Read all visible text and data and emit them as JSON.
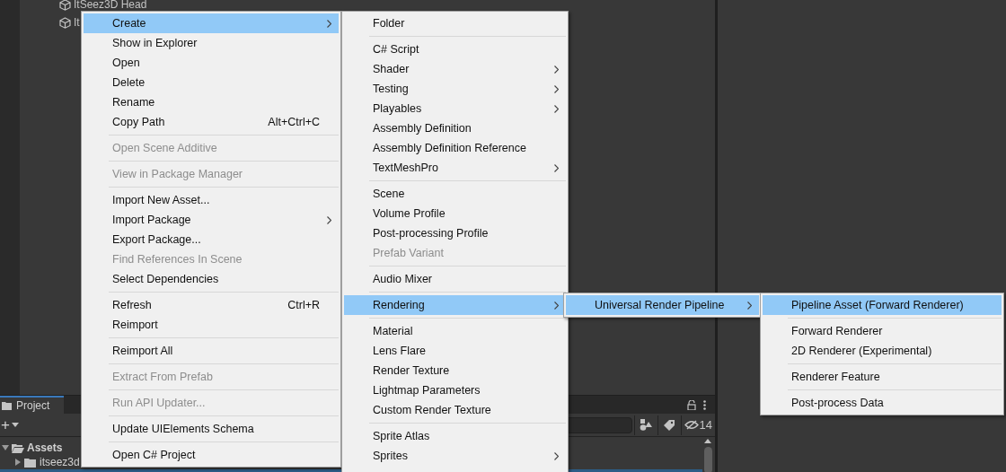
{
  "hierarchy": {
    "items": [
      {
        "label": "ItSeez3D Head"
      },
      {
        "label": "It"
      }
    ]
  },
  "project_panel": {
    "tab": "Project",
    "add_button": "+",
    "hidden_count": "14",
    "tree": [
      {
        "label": "Assets",
        "expanded": true,
        "children": [
          {
            "label": "itseez3d",
            "expanded": false
          }
        ]
      }
    ]
  },
  "menus": [
    {
      "items": [
        {
          "kind": "item",
          "label": "Create",
          "submenu": true,
          "selected": true,
          "disabled": false
        },
        {
          "kind": "item",
          "label": "Show in Explorer",
          "submenu": false,
          "selected": false,
          "disabled": false
        },
        {
          "kind": "item",
          "label": "Open",
          "submenu": false,
          "selected": false,
          "disabled": false
        },
        {
          "kind": "item",
          "label": "Delete",
          "submenu": false,
          "selected": false,
          "disabled": false
        },
        {
          "kind": "item",
          "label": "Rename",
          "submenu": false,
          "selected": false,
          "disabled": false
        },
        {
          "kind": "item",
          "label": "Copy Path",
          "shortcut": "Alt+Ctrl+C",
          "submenu": false,
          "selected": false,
          "disabled": false
        },
        {
          "kind": "separator"
        },
        {
          "kind": "item",
          "label": "Open Scene Additive",
          "submenu": false,
          "selected": false,
          "disabled": true
        },
        {
          "kind": "separator"
        },
        {
          "kind": "item",
          "label": "View in Package Manager",
          "submenu": false,
          "selected": false,
          "disabled": true
        },
        {
          "kind": "separator"
        },
        {
          "kind": "item",
          "label": "Import New Asset...",
          "submenu": false,
          "selected": false,
          "disabled": false
        },
        {
          "kind": "item",
          "label": "Import Package",
          "submenu": true,
          "selected": false,
          "disabled": false
        },
        {
          "kind": "item",
          "label": "Export Package...",
          "submenu": false,
          "selected": false,
          "disabled": false
        },
        {
          "kind": "item",
          "label": "Find References In Scene",
          "submenu": false,
          "selected": false,
          "disabled": true
        },
        {
          "kind": "item",
          "label": "Select Dependencies",
          "submenu": false,
          "selected": false,
          "disabled": false
        },
        {
          "kind": "separator"
        },
        {
          "kind": "item",
          "label": "Refresh",
          "shortcut": "Ctrl+R",
          "submenu": false,
          "selected": false,
          "disabled": false
        },
        {
          "kind": "item",
          "label": "Reimport",
          "submenu": false,
          "selected": false,
          "disabled": false
        },
        {
          "kind": "separator"
        },
        {
          "kind": "item",
          "label": "Reimport All",
          "submenu": false,
          "selected": false,
          "disabled": false
        },
        {
          "kind": "separator"
        },
        {
          "kind": "item",
          "label": "Extract From Prefab",
          "submenu": false,
          "selected": false,
          "disabled": true
        },
        {
          "kind": "separator"
        },
        {
          "kind": "item",
          "label": "Run API Updater...",
          "submenu": false,
          "selected": false,
          "disabled": true
        },
        {
          "kind": "separator"
        },
        {
          "kind": "item",
          "label": "Update UIElements Schema",
          "submenu": false,
          "selected": false,
          "disabled": false
        },
        {
          "kind": "separator"
        },
        {
          "kind": "item",
          "label": "Open C# Project",
          "submenu": false,
          "selected": false,
          "disabled": false
        }
      ]
    },
    {
      "items": [
        {
          "kind": "item",
          "label": "Folder",
          "submenu": false,
          "selected": false,
          "disabled": false
        },
        {
          "kind": "separator"
        },
        {
          "kind": "item",
          "label": "C# Script",
          "submenu": false,
          "selected": false,
          "disabled": false
        },
        {
          "kind": "item",
          "label": "Shader",
          "submenu": true,
          "selected": false,
          "disabled": false
        },
        {
          "kind": "item",
          "label": "Testing",
          "submenu": true,
          "selected": false,
          "disabled": false
        },
        {
          "kind": "item",
          "label": "Playables",
          "submenu": true,
          "selected": false,
          "disabled": false
        },
        {
          "kind": "item",
          "label": "Assembly Definition",
          "submenu": false,
          "selected": false,
          "disabled": false
        },
        {
          "kind": "item",
          "label": "Assembly Definition Reference",
          "submenu": false,
          "selected": false,
          "disabled": false
        },
        {
          "kind": "item",
          "label": "TextMeshPro",
          "submenu": true,
          "selected": false,
          "disabled": false
        },
        {
          "kind": "separator"
        },
        {
          "kind": "item",
          "label": "Scene",
          "submenu": false,
          "selected": false,
          "disabled": false
        },
        {
          "kind": "item",
          "label": "Volume Profile",
          "submenu": false,
          "selected": false,
          "disabled": false
        },
        {
          "kind": "item",
          "label": "Post-processing Profile",
          "submenu": false,
          "selected": false,
          "disabled": false
        },
        {
          "kind": "item",
          "label": "Prefab Variant",
          "submenu": false,
          "selected": false,
          "disabled": true
        },
        {
          "kind": "separator"
        },
        {
          "kind": "item",
          "label": "Audio Mixer",
          "submenu": false,
          "selected": false,
          "disabled": false
        },
        {
          "kind": "separator"
        },
        {
          "kind": "item",
          "label": "Rendering",
          "submenu": true,
          "selected": true,
          "disabled": false
        },
        {
          "kind": "separator"
        },
        {
          "kind": "item",
          "label": "Material",
          "submenu": false,
          "selected": false,
          "disabled": false
        },
        {
          "kind": "item",
          "label": "Lens Flare",
          "submenu": false,
          "selected": false,
          "disabled": false
        },
        {
          "kind": "item",
          "label": "Render Texture",
          "submenu": false,
          "selected": false,
          "disabled": false
        },
        {
          "kind": "item",
          "label": "Lightmap Parameters",
          "submenu": false,
          "selected": false,
          "disabled": false
        },
        {
          "kind": "item",
          "label": "Custom Render Texture",
          "submenu": false,
          "selected": false,
          "disabled": false
        },
        {
          "kind": "separator"
        },
        {
          "kind": "item",
          "label": "Sprite Atlas",
          "submenu": false,
          "selected": false,
          "disabled": false
        },
        {
          "kind": "item",
          "label": "Sprites",
          "submenu": true,
          "selected": false,
          "disabled": false
        }
      ]
    },
    {
      "items": [
        {
          "kind": "item",
          "label": "Universal Render Pipeline",
          "submenu": true,
          "selected": true,
          "disabled": false
        }
      ]
    },
    {
      "items": [
        {
          "kind": "item",
          "label": "Pipeline Asset (Forward Renderer)",
          "submenu": false,
          "selected": true,
          "disabled": false
        },
        {
          "kind": "separator"
        },
        {
          "kind": "item",
          "label": "Forward Renderer",
          "submenu": false,
          "selected": false,
          "disabled": false
        },
        {
          "kind": "item",
          "label": "2D Renderer (Experimental)",
          "submenu": false,
          "selected": false,
          "disabled": false
        },
        {
          "kind": "separator"
        },
        {
          "kind": "item",
          "label": "Renderer Feature",
          "submenu": false,
          "selected": false,
          "disabled": false
        },
        {
          "kind": "separator"
        },
        {
          "kind": "item",
          "label": "Post-process Data",
          "submenu": false,
          "selected": false,
          "disabled": false
        }
      ]
    }
  ]
}
